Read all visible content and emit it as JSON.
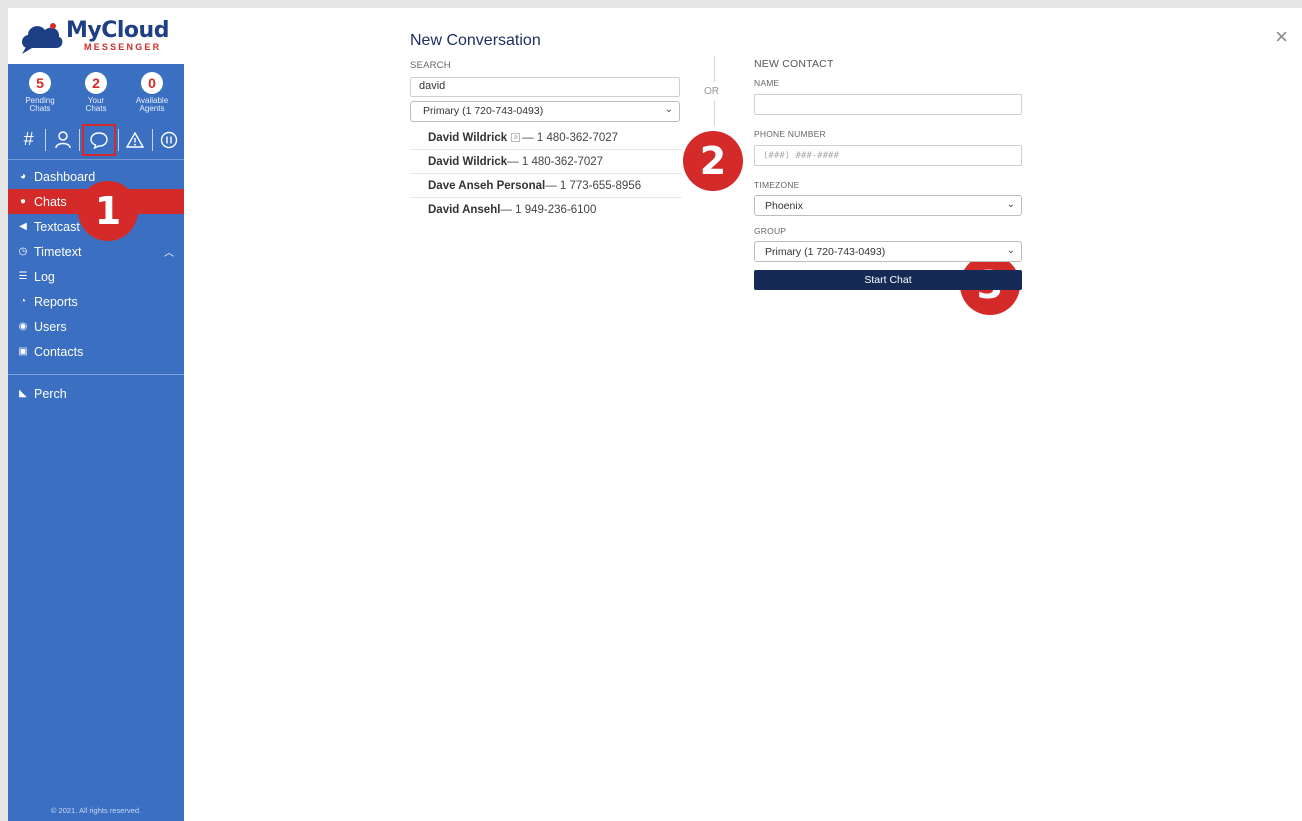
{
  "brand": {
    "name": "MyCloud",
    "sub": "MESSENGER"
  },
  "stats": [
    {
      "value": "5",
      "label": "Pending\nChats"
    },
    {
      "value": "2",
      "label": "Your\nChats"
    },
    {
      "value": "0",
      "label": "Available\nAgents"
    }
  ],
  "toolbar": {
    "hash_icon": "#",
    "user_icon": "user-icon",
    "chat_icon": "chat-bubble-icon",
    "alert_icon": "warning-icon",
    "pause_icon": "pause-icon"
  },
  "nav": [
    {
      "label": "Dashboard",
      "icon": "dashboard-icon"
    },
    {
      "label": "Chats",
      "icon": "chat-icon"
    },
    {
      "label": "Textcast",
      "icon": "broadcast-icon"
    },
    {
      "label": "Timetext",
      "icon": "clock-icon"
    },
    {
      "label": "Log",
      "icon": "list-icon"
    },
    {
      "label": "Reports",
      "icon": "pie-chart-icon"
    },
    {
      "label": "Users",
      "icon": "user-circle-icon"
    },
    {
      "label": "Contacts",
      "icon": "address-card-icon"
    }
  ],
  "nav_extra": {
    "label": "Perch",
    "icon": "perch-icon"
  },
  "footer": "© 2021. All rights reserved.",
  "callouts": [
    "1",
    "2",
    "3"
  ],
  "dialog": {
    "title": "New Conversation",
    "close": "×",
    "or": "OR",
    "search": {
      "label": "SEARCH",
      "value": "david",
      "group": "Primary (1 720-743-0493)",
      "results": [
        {
          "name": "David Wildrick",
          "tag": "a",
          "phone": " — 1 480-362-7027"
        },
        {
          "name": "David Wildrick",
          "tag": "",
          "phone": " — 1 480-362-7027"
        },
        {
          "name": "Dave Anseh Personal",
          "tag": "",
          "phone": " — 1 773-655-8956"
        },
        {
          "name": "David Ansehl",
          "tag": "",
          "phone": " — 1 949-236-6100"
        }
      ]
    },
    "contact": {
      "heading": "NEW CONTACT",
      "name_label": "NAME",
      "name_value": "",
      "phone_label": "PHONE NUMBER",
      "phone_placeholder": "(###) ###-####",
      "timezone_label": "TIMEZONE",
      "timezone_value": "Phoenix",
      "group_label": "GROUP",
      "group_value": "Primary (1 720-743-0493)",
      "start_label": "Start Chat"
    }
  }
}
